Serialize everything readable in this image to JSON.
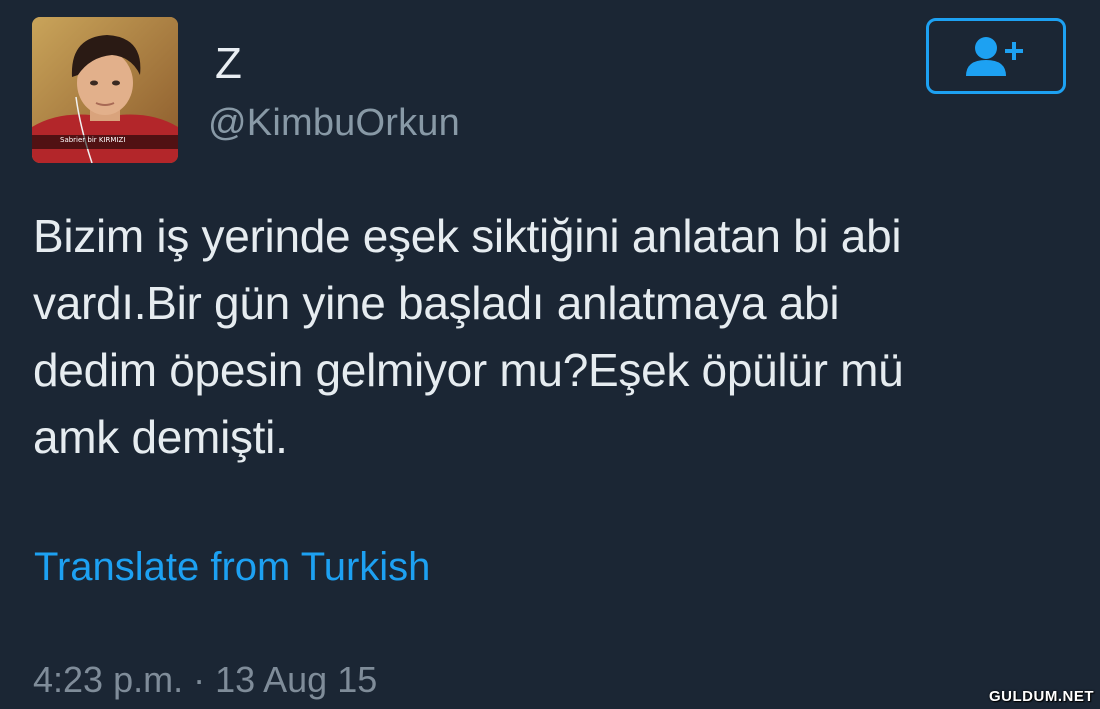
{
  "user": {
    "display_name": "Z",
    "handle": "@KimbuOrkun",
    "avatar_caption": "Sabrier bir KIRMIZI"
  },
  "follow_button": {
    "icon": "add-user-icon"
  },
  "tweet": {
    "text_lines": [
      "Bizim iş yerinde eşek siktiğini anlatan bi abi",
      "vardı.Bir gün yine başladı anlatmaya abi",
      "dedim öpesin gelmiyor mu?Eşek öpülür mü",
      "amk demişti."
    ],
    "translate_label": "Translate from Turkish",
    "timestamp": "4:23 p.m. · 13 Aug 15"
  },
  "watermark": "GULDUM.NET",
  "colors": {
    "background": "#1b2634",
    "accent": "#1da1f2",
    "text": "#e6ecf0",
    "muted": "#8899a6"
  }
}
